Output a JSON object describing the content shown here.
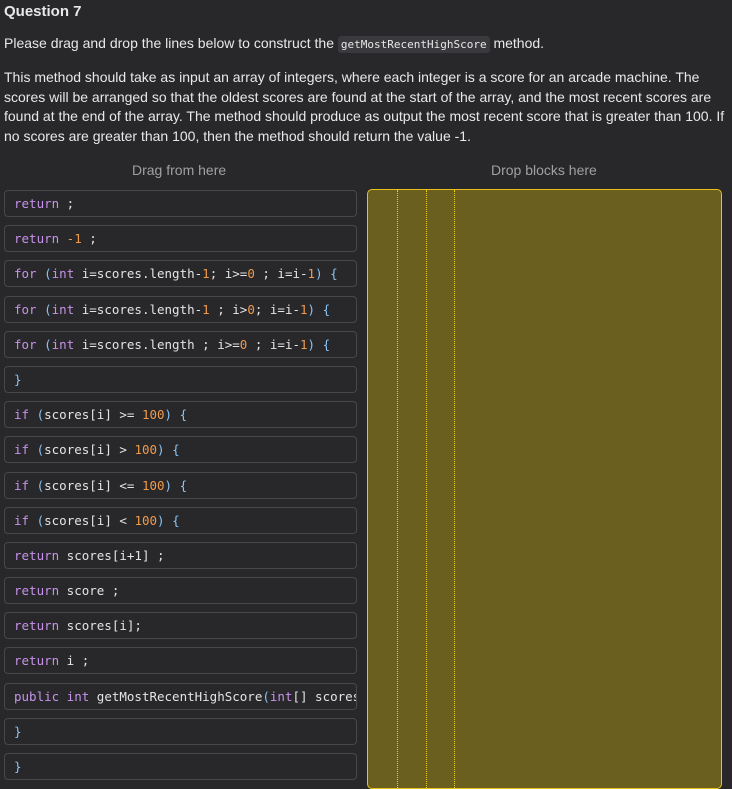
{
  "question_title": "Question 7",
  "intro_before": "Please drag and drop the lines below to construct the ",
  "intro_code": "getMostRecentHighScore",
  "intro_after": " method.",
  "description": "This method should take as input an array of integers, where each integer is a score for an arcade machine. The scores will be arranged so that the oldest scores are found at the start of the array, and the most recent scores are found at the end of the array. The method should produce as output the most recent score that is greater than 100. If no scores are greater than 100, then the method should return the value -1.",
  "drag_header": "Drag from here",
  "drop_header": "Drop blocks here",
  "colors": {
    "background": "#28282b",
    "drop_zone": "#6b5f1f",
    "drop_border": "#e6c21a",
    "keyword": "#c792ea",
    "number": "#f09a4a"
  },
  "blocks": [
    [
      [
        "kw",
        "return"
      ],
      [
        "tx",
        " ;"
      ]
    ],
    [
      [
        "kw",
        "return"
      ],
      [
        "num",
        " -1"
      ],
      [
        "tx",
        " ;"
      ]
    ],
    [
      [
        "kw",
        "for"
      ],
      [
        "pn",
        " ("
      ],
      [
        "kw",
        "int"
      ],
      [
        "tx",
        " i=scores.length-"
      ],
      [
        "num",
        "1"
      ],
      [
        "tx",
        "; i>="
      ],
      [
        "num",
        "0"
      ],
      [
        "tx",
        " ; i=i-"
      ],
      [
        "num",
        "1"
      ],
      [
        "pn",
        ") {"
      ]
    ],
    [
      [
        "kw",
        "for"
      ],
      [
        "pn",
        " ("
      ],
      [
        "kw",
        "int"
      ],
      [
        "tx",
        " i=scores.length-"
      ],
      [
        "num",
        "1"
      ],
      [
        "tx",
        " ; i>"
      ],
      [
        "num",
        "0"
      ],
      [
        "tx",
        "; i=i-"
      ],
      [
        "num",
        "1"
      ],
      [
        "pn",
        ") {"
      ]
    ],
    [
      [
        "kw",
        "for"
      ],
      [
        "pn",
        " ("
      ],
      [
        "kw",
        "int"
      ],
      [
        "tx",
        " i=scores.length ; i>="
      ],
      [
        "num",
        "0"
      ],
      [
        "tx",
        " ; i=i-"
      ],
      [
        "num",
        "1"
      ],
      [
        "pn",
        ") {"
      ]
    ],
    [
      [
        "pn",
        "}"
      ]
    ],
    [
      [
        "kw",
        "if"
      ],
      [
        "pn",
        " ("
      ],
      [
        "tx",
        "scores[i] >= "
      ],
      [
        "num",
        "100"
      ],
      [
        "pn",
        ") {"
      ]
    ],
    [
      [
        "kw",
        "if"
      ],
      [
        "pn",
        " ("
      ],
      [
        "tx",
        "scores[i] > "
      ],
      [
        "num",
        "100"
      ],
      [
        "pn",
        ") {"
      ]
    ],
    [
      [
        "kw",
        "if"
      ],
      [
        "pn",
        " ("
      ],
      [
        "tx",
        "scores[i] <= "
      ],
      [
        "num",
        "100"
      ],
      [
        "pn",
        ") {"
      ]
    ],
    [
      [
        "kw",
        "if"
      ],
      [
        "pn",
        " ("
      ],
      [
        "tx",
        "scores[i] < "
      ],
      [
        "num",
        "100"
      ],
      [
        "pn",
        ") {"
      ]
    ],
    [
      [
        "kw",
        "return"
      ],
      [
        "tx",
        " scores[i+1] ;"
      ]
    ],
    [
      [
        "kw",
        "return"
      ],
      [
        "tx",
        " score ;"
      ]
    ],
    [
      [
        "kw",
        "return"
      ],
      [
        "tx",
        " scores[i];"
      ]
    ],
    [
      [
        "kw",
        "return"
      ],
      [
        "tx",
        " i ;"
      ]
    ],
    [
      [
        "kw",
        "public"
      ],
      [
        "kw",
        " int"
      ],
      [
        "tx",
        " getMostRecentHighScore"
      ],
      [
        "pn",
        "("
      ],
      [
        "kw",
        "int"
      ],
      [
        "tx",
        "[] scores"
      ]
    ],
    [
      [
        "pn",
        "}"
      ]
    ],
    [
      [
        "pn",
        "}"
      ]
    ]
  ]
}
